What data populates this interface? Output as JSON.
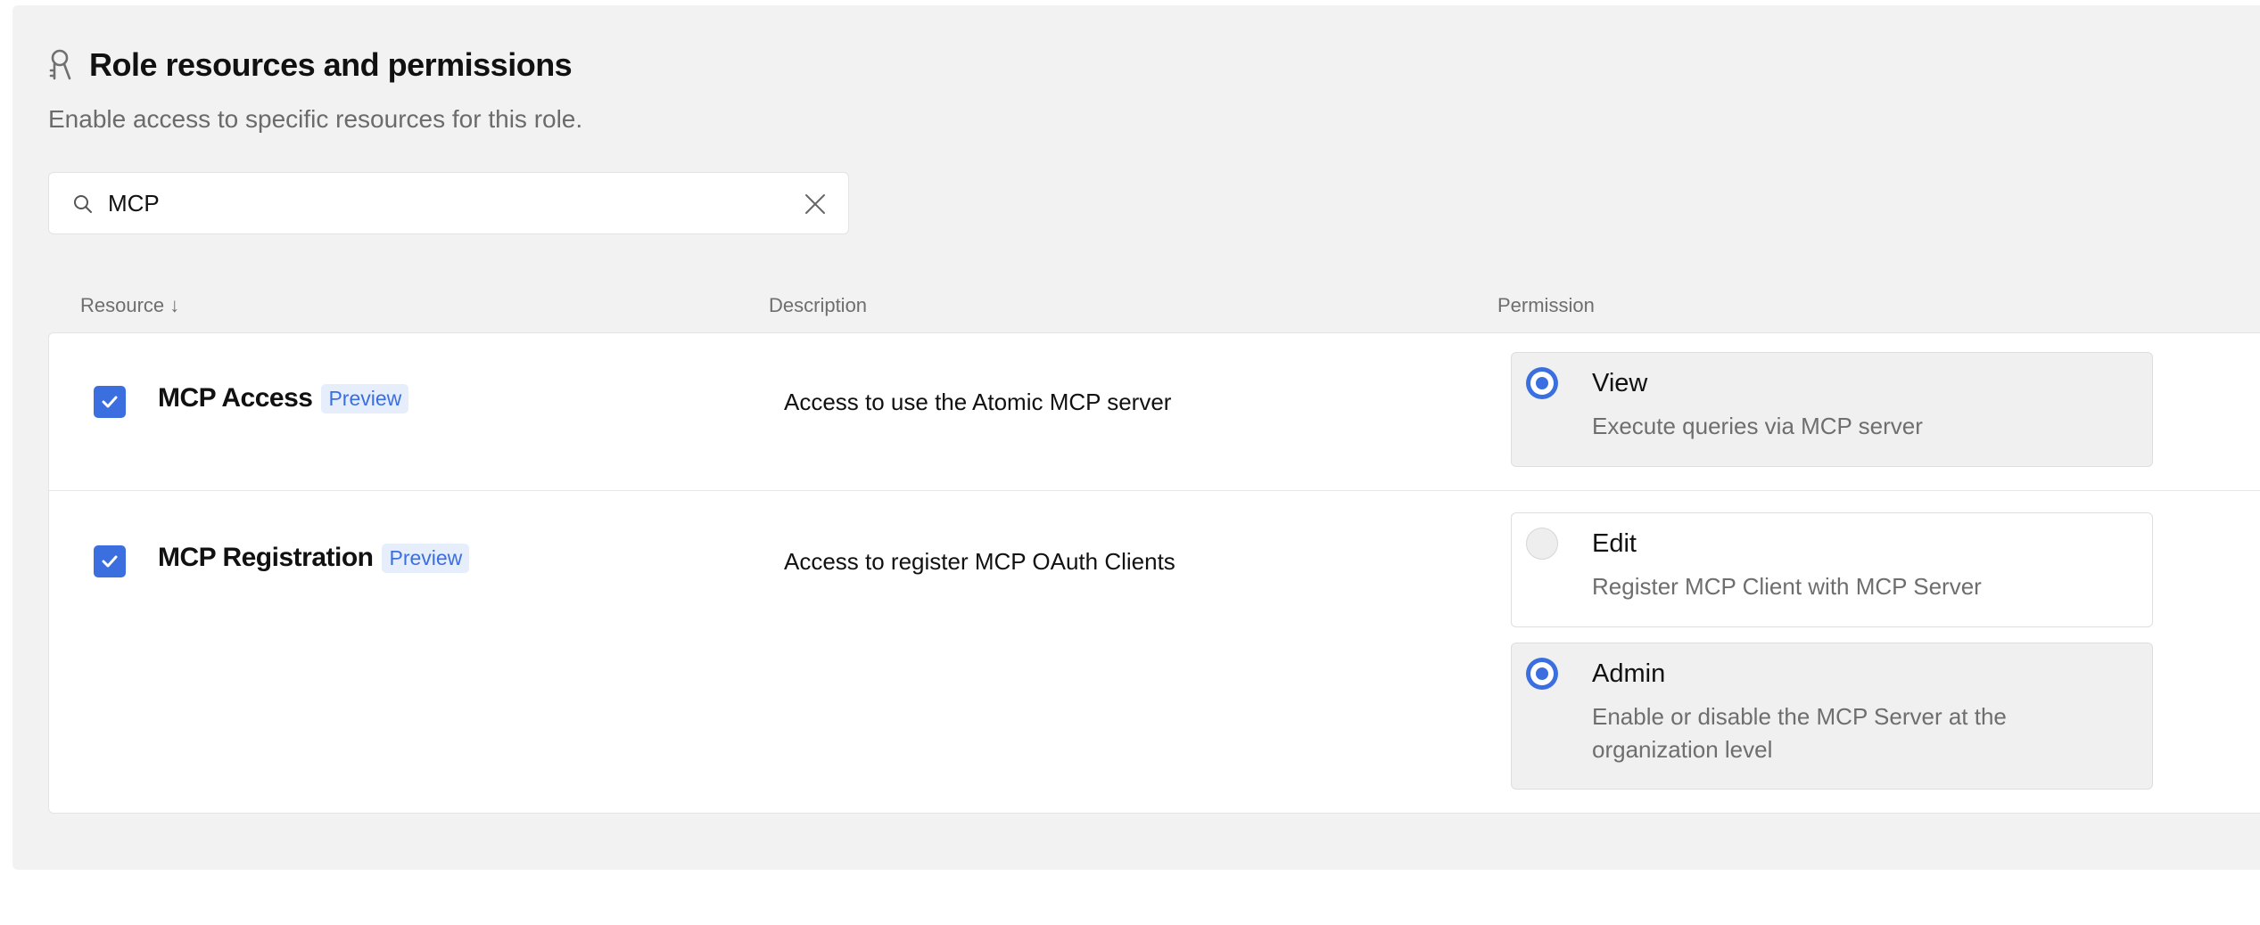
{
  "header": {
    "icon": "key-person-icon",
    "title": "Role resources and permissions",
    "subtitle": "Enable access to specific resources for this role."
  },
  "search": {
    "value": "MCP",
    "placeholder": "Search"
  },
  "table": {
    "columns": {
      "resource": "Resource ↓",
      "description": "Description",
      "permission": "Permission"
    },
    "rows": [
      {
        "checked": true,
        "name": "MCP Access",
        "badge": "Preview",
        "description": "Access to use the Atomic MCP server",
        "permissions": [
          {
            "title": "View",
            "description": "Execute queries via MCP server",
            "selected": true
          }
        ]
      },
      {
        "checked": true,
        "name": "MCP Registration",
        "badge": "Preview",
        "description": "Access to register MCP OAuth Clients",
        "permissions": [
          {
            "title": "Edit",
            "description": "Register MCP Client with MCP Server",
            "selected": false
          },
          {
            "title": "Admin",
            "description": "Enable or disable the MCP Server at the organization level",
            "selected": true
          }
        ]
      }
    ]
  },
  "colors": {
    "accent": "#3b6fe0",
    "badge_bg": "#e6eefc",
    "panel_bg": "#f2f2f2"
  }
}
